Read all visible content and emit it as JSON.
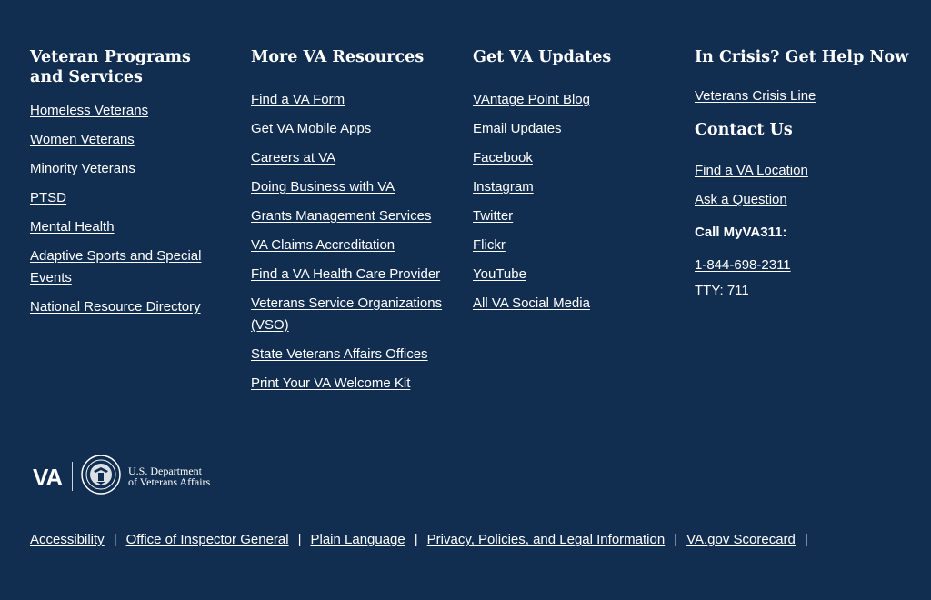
{
  "columns": [
    {
      "title": "Veteran Programs and Services",
      "links": [
        "Homeless Veterans",
        "Women Veterans",
        "Minority Veterans",
        "PTSD",
        "Mental Health",
        "Adaptive Sports and Special Events",
        "National Resource Directory"
      ]
    },
    {
      "title": "More VA Resources",
      "links": [
        "Find a VA Form",
        "Get VA Mobile Apps",
        "Careers at VA",
        "Doing Business with VA",
        "Grants Management Services",
        "VA Claims Accreditation",
        "Find a VA Health Care Provider",
        "Veterans Service Organizations (VSO)",
        "State Veterans Affairs Offices",
        "Print Your VA Welcome Kit"
      ]
    },
    {
      "title": "Get VA Updates",
      "links": [
        "VAntage Point Blog",
        "Email Updates",
        "Facebook",
        "Instagram",
        "Twitter",
        "Flickr",
        "YouTube",
        "All VA Social Media"
      ]
    }
  ],
  "crisis": {
    "title": "In Crisis? Get Help Now",
    "link": "Veterans Crisis Line"
  },
  "contact": {
    "title": "Contact Us",
    "links": [
      "Find a VA Location",
      "Ask a Question"
    ],
    "call_label": "Call MyVA311:",
    "phone": "1-844-698-2311",
    "tty": "TTY: 711"
  },
  "logo": {
    "va_text": "VA",
    "dept_line1": "U.S. Department",
    "dept_line2": "of Veterans Affairs"
  },
  "bottom_links": [
    "Accessibility",
    "Office of Inspector General",
    "Plain Language",
    "Privacy, Policies, and Legal Information",
    "VA.gov Scorecard"
  ],
  "separator": "|",
  "colors": {
    "background": "#112e51",
    "text": "#ffffff"
  }
}
